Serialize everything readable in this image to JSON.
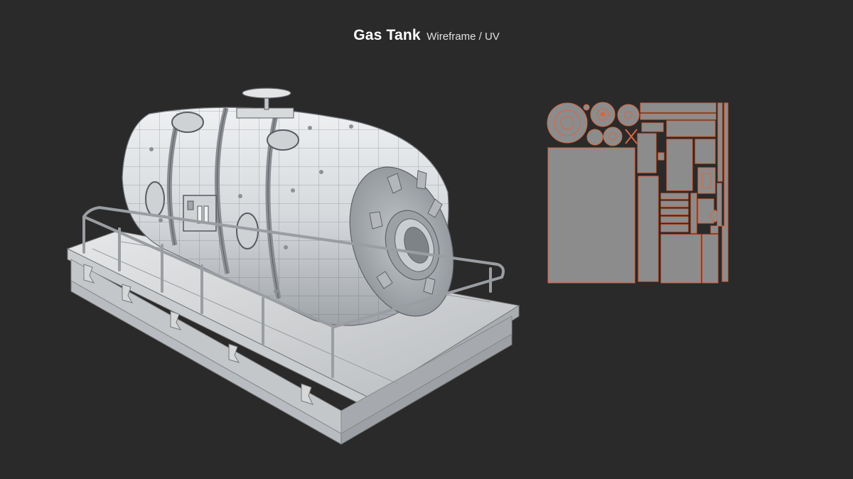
{
  "header": {
    "title": "Gas Tank",
    "subtitle": "Wireframe / UV"
  },
  "colors": {
    "background": "#2a2a2a",
    "model": "#d8dadc",
    "uv_island_fill": "#8c8c8c",
    "uv_island_edge": "#d9663f"
  }
}
